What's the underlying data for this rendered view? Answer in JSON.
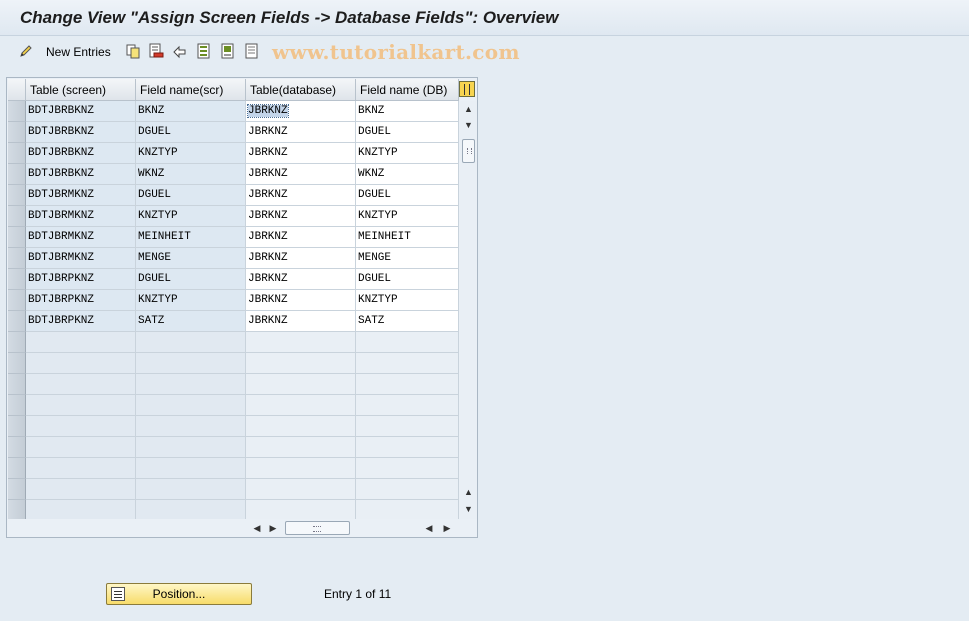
{
  "window": {
    "title": "Change View \"Assign Screen Fields -> Database Fields\": Overview"
  },
  "toolbar": {
    "new_entries_label": "New Entries",
    "icons": [
      "new-entries-icon",
      "copy-icon",
      "delete-icon",
      "undo-icon",
      "select-all-icon",
      "select-block-icon",
      "deselect-all-icon"
    ],
    "watermark": "www.tutorialkart.com"
  },
  "table": {
    "columns": [
      "Table (screen)",
      "Field name(scr)",
      "Table(database)",
      "Field name (DB)"
    ],
    "rows": [
      [
        "BDTJBRBKNZ",
        "BKNZ",
        "JBRKNZ",
        "BKNZ"
      ],
      [
        "BDTJBRBKNZ",
        "DGUEL",
        "JBRKNZ",
        "DGUEL"
      ],
      [
        "BDTJBRBKNZ",
        "KNZTYP",
        "JBRKNZ",
        "KNZTYP"
      ],
      [
        "BDTJBRBKNZ",
        "WKNZ",
        "JBRKNZ",
        "WKNZ"
      ],
      [
        "BDTJBRMKNZ",
        "DGUEL",
        "JBRKNZ",
        "DGUEL"
      ],
      [
        "BDTJBRMKNZ",
        "KNZTYP",
        "JBRKNZ",
        "KNZTYP"
      ],
      [
        "BDTJBRMKNZ",
        "MEINHEIT",
        "JBRKNZ",
        "MEINHEIT"
      ],
      [
        "BDTJBRMKNZ",
        "MENGE",
        "JBRKNZ",
        "MENGE"
      ],
      [
        "BDTJBRPKNZ",
        "DGUEL",
        "JBRKNZ",
        "DGUEL"
      ],
      [
        "BDTJBRPKNZ",
        "KNZTYP",
        "JBRKNZ",
        "KNZTYP"
      ],
      [
        "BDTJBRPKNZ",
        "SATZ",
        "JBRKNZ",
        "SATZ"
      ]
    ],
    "empty_rows": 9
  },
  "footer": {
    "position_button": "Position...",
    "entry_info": "Entry 1 of 11"
  }
}
